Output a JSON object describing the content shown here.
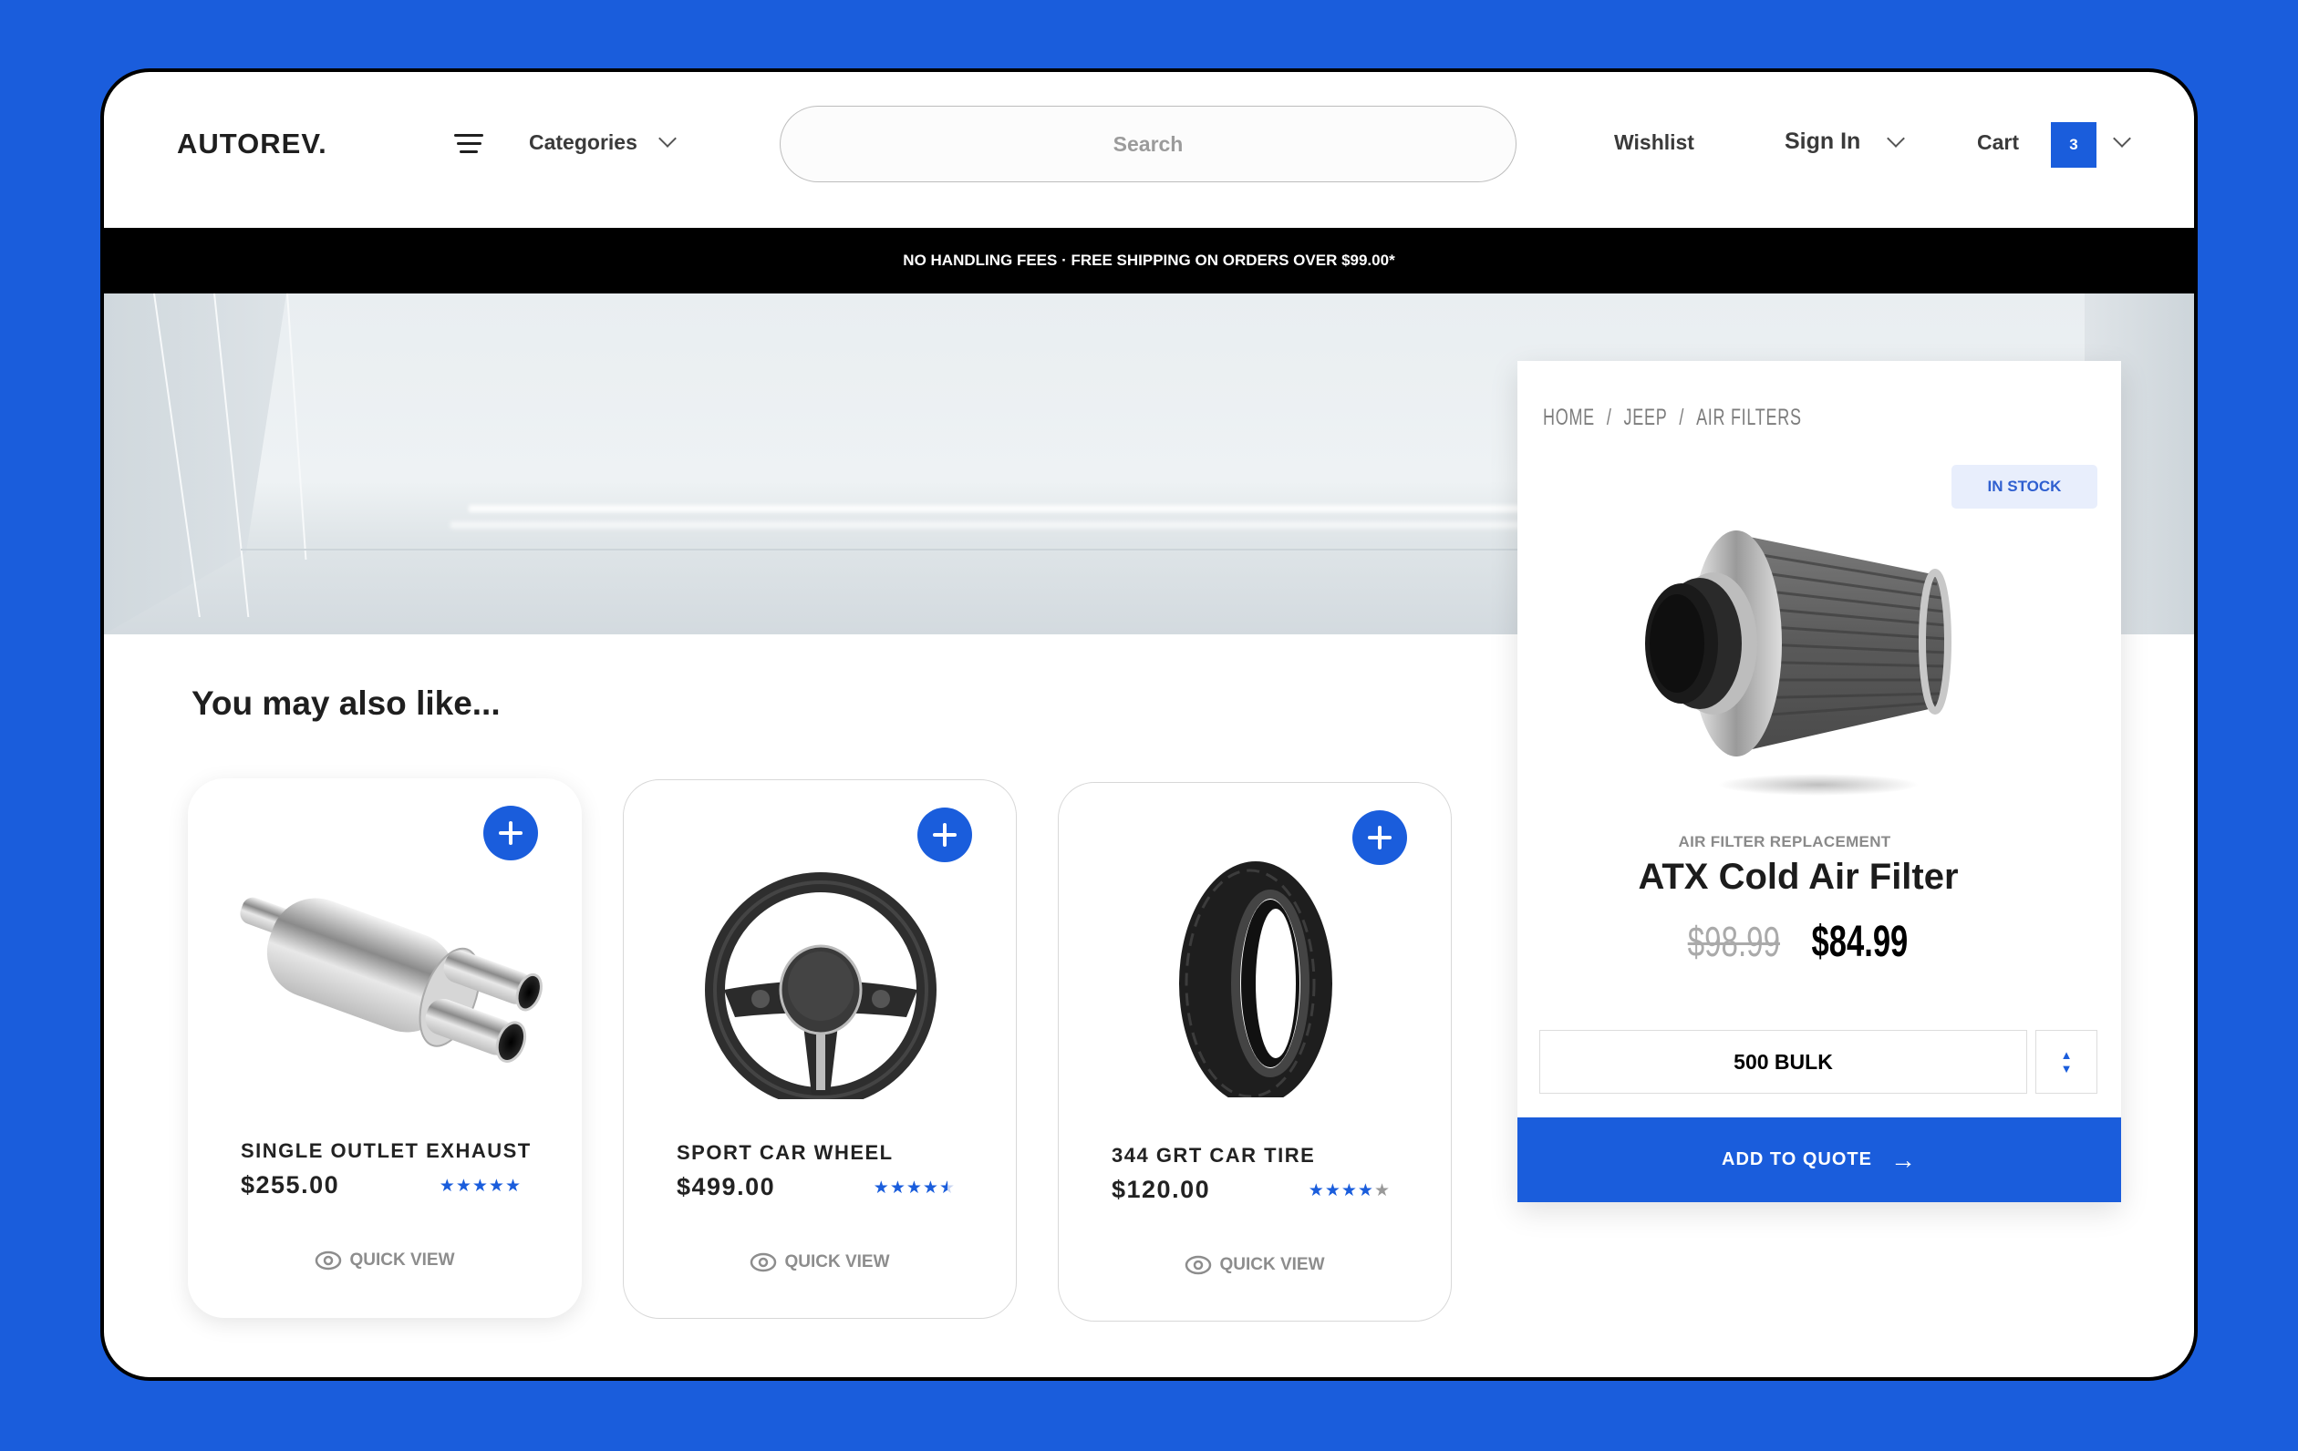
{
  "header": {
    "logo": "AUTOREV.",
    "categories_label": "Categories",
    "search_placeholder": "Search",
    "wishlist_label": "Wishlist",
    "signin_label": "Sign In",
    "cart_label": "Cart",
    "cart_count": "3"
  },
  "promo_banner": "NO HANDLING FEES · FREE SHIPPING ON ORDERS OVER $99.00*",
  "product": {
    "breadcrumb": [
      "HOME",
      "JEEP",
      "AIR FILTERS"
    ],
    "breadcrumb_separator": "/",
    "stock_status": "IN STOCK",
    "category": "AIR FILTER REPLACEMENT",
    "title": "ATX Cold Air Filter",
    "old_price": "$98.99",
    "price": "$84.99",
    "quantity_value": "500 BULK",
    "stepper_up": "▲",
    "stepper_down": "▼",
    "add_to_quote_label": "ADD TO QUOTE",
    "add_to_quote_arrow": "→"
  },
  "recommended": {
    "title": "You may also like...",
    "quick_view_label": "QUICK VIEW",
    "items": [
      {
        "name": "SINGLE OUTLET EXHAUST",
        "price": "$255.00",
        "rating": 5,
        "image": "exhaust-muffler"
      },
      {
        "name": "SPORT CAR WHEEL",
        "price": "$499.00",
        "rating": 4.5,
        "image": "steering-wheel"
      },
      {
        "name": "344 GRT CAR TIRE",
        "price": "$120.00",
        "rating": 4,
        "image": "car-tire"
      }
    ]
  },
  "colors": {
    "brand_blue": "#1a5ddc",
    "banner_black": "#000000",
    "stock_badge_bg": "#e8eefc"
  }
}
